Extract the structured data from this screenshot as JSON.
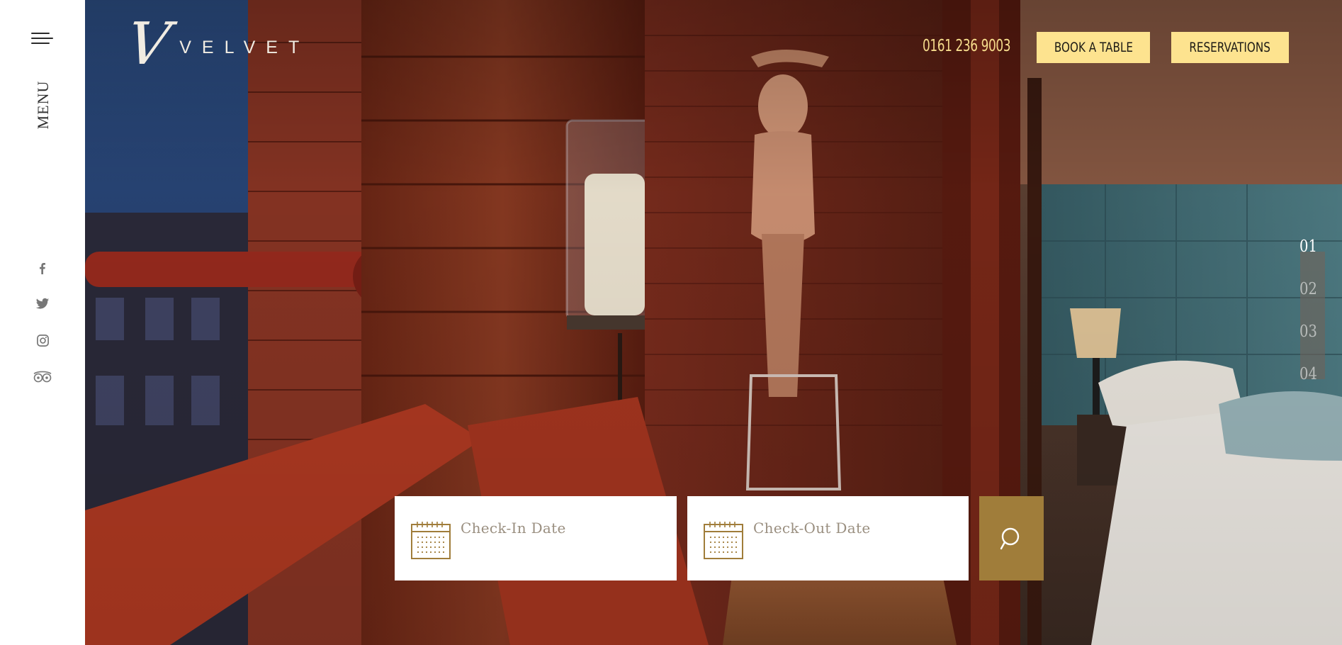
{
  "sidebar": {
    "menu_label": "MENU",
    "social": [
      {
        "icon": "facebook-icon"
      },
      {
        "icon": "twitter-icon"
      },
      {
        "icon": "instagram-icon"
      },
      {
        "icon": "tripadvisor-icon"
      }
    ]
  },
  "header": {
    "logo_monogram": "V",
    "logo_text": "VELVET",
    "phone": "0161 236 9003",
    "book_table_label": "BOOK A TABLE",
    "reservations_label": "RESERVATIONS"
  },
  "slider": {
    "items": [
      "01",
      "02",
      "03",
      "04"
    ],
    "active_index": 0
  },
  "booking": {
    "checkin_placeholder": "Check-In Date",
    "checkout_placeholder": "Check-Out Date",
    "search_icon": "search-icon",
    "calendar_icon": "calendar-icon"
  },
  "colors": {
    "accent_gold": "#a07d3a",
    "button_yellow": "#fde38f",
    "phone_color": "#f6dc8c"
  }
}
